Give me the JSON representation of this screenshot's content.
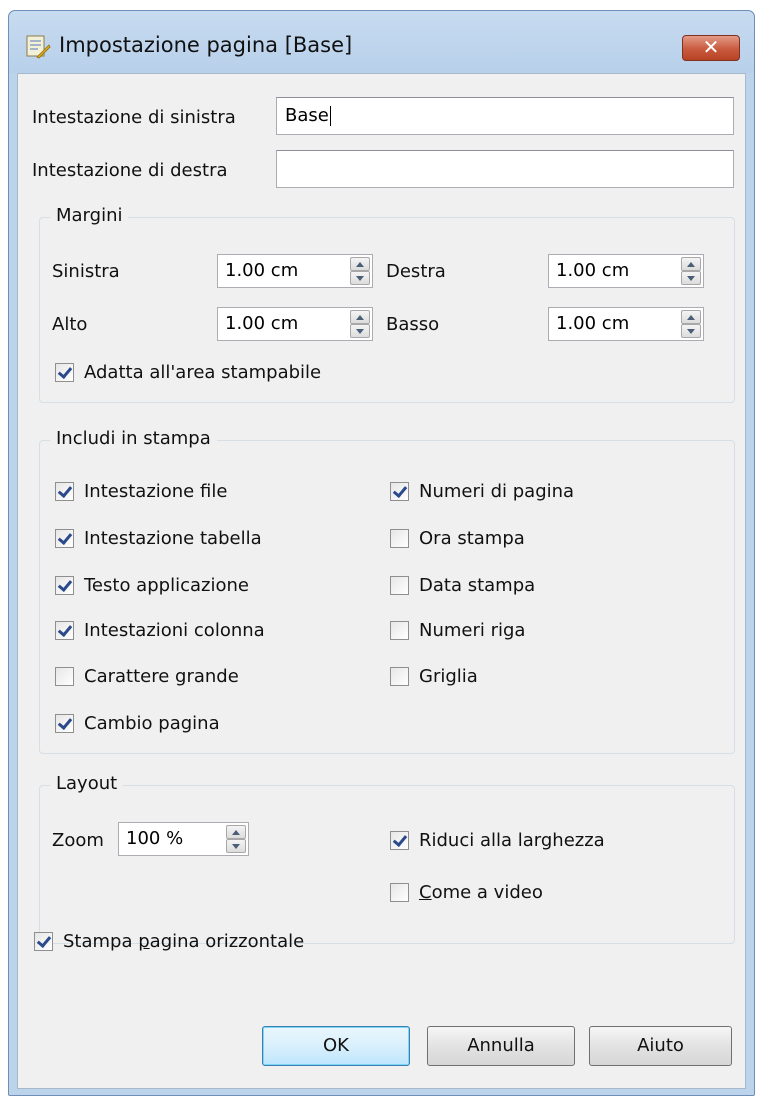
{
  "window": {
    "title": "Impostazione pagina [Base]",
    "close_label": "✕"
  },
  "header": {
    "left_label": "Intestazione di sinistra",
    "left_value": "Base",
    "right_label": "Intestazione di destra",
    "right_value": ""
  },
  "margins": {
    "group_label": "Margini",
    "left_label": "Sinistra",
    "left_value": "1.00 cm",
    "right_label": "Destra",
    "right_value": "1.00 cm",
    "top_label": "Alto",
    "top_value": "1.00 cm",
    "bottom_label": "Basso",
    "bottom_value": "1.00 cm",
    "fit_label": "Adatta all'area stampabile",
    "fit_checked": true
  },
  "include": {
    "group_label": "Includi in stampa",
    "left_items": [
      {
        "label": "Intestazione file",
        "checked": true
      },
      {
        "label": "Intestazione tabella",
        "checked": true
      },
      {
        "label": "Testo applicazione",
        "checked": true
      },
      {
        "label": "Intestazioni colonna",
        "checked": true
      },
      {
        "label": "Carattere grande",
        "checked": false
      },
      {
        "label": "Cambio pagina",
        "checked": true
      }
    ],
    "right_items": [
      {
        "label": "Numeri di pagina",
        "checked": true
      },
      {
        "label": "Ora stampa",
        "checked": false
      },
      {
        "label": "Data stampa",
        "checked": false
      },
      {
        "label": "Numeri riga",
        "checked": false
      },
      {
        "label": "Griglia",
        "checked": false
      }
    ]
  },
  "layout": {
    "group_label": "Layout",
    "zoom_label": "Zoom",
    "zoom_value": "100 %",
    "fit_width_label": "Riduci alla larghezza",
    "fit_width_checked": true,
    "as_screen_prefix": "C",
    "as_screen_rest": "ome a video",
    "as_screen_checked": false
  },
  "landscape": {
    "prefix": "Stampa ",
    "accel": "p",
    "rest": "agina orizzontale",
    "checked": true
  },
  "buttons": {
    "ok": "OK",
    "cancel": "Annulla",
    "help": "Aiuto"
  },
  "colors": {
    "title_bar": "#bcd3ec",
    "close_button": "#c85a3e",
    "dialog_bg": "#f0f0f0",
    "check_mark": "#2b4a8c"
  }
}
